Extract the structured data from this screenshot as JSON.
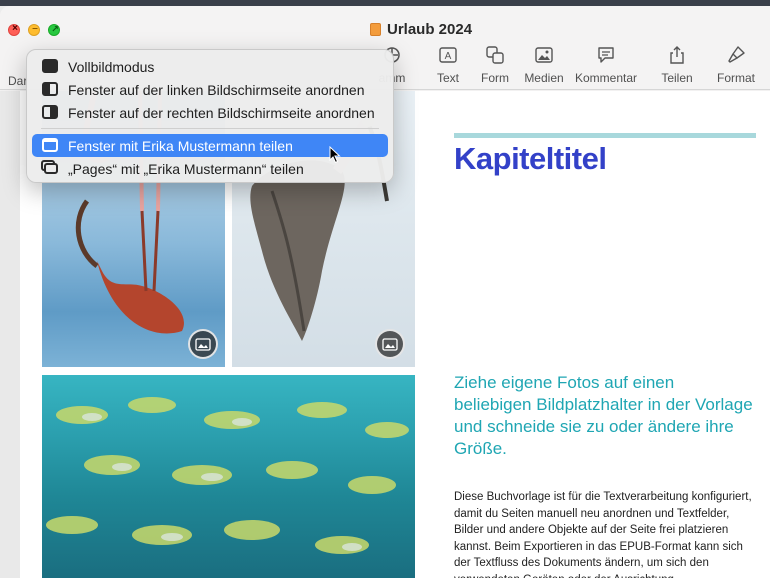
{
  "window": {
    "title": "Urlaub 2024"
  },
  "toolbar": {
    "left_partial_label": "Dar",
    "items": [
      {
        "label": "amm",
        "icon": "chart-icon"
      },
      {
        "label": "Text",
        "icon": "text-box-icon"
      },
      {
        "label": "Form",
        "icon": "shape-icon"
      },
      {
        "label": "Medien",
        "icon": "media-icon"
      },
      {
        "label": "Kommentar",
        "icon": "comment-icon"
      },
      {
        "label": "Teilen",
        "icon": "share-icon"
      },
      {
        "label": "Format",
        "icon": "format-brush-icon"
      }
    ]
  },
  "menu": {
    "items": [
      {
        "label": "Vollbildmodus",
        "icon": "fullscreen-icon"
      },
      {
        "label": "Fenster auf der linken Bildschirmseite anordnen",
        "icon": "tile-left-icon"
      },
      {
        "label": "Fenster auf der rechten Bildschirmseite anordnen",
        "icon": "tile-right-icon"
      },
      {
        "label": "Fenster mit Erika Mustermann teilen",
        "icon": "share-window-icon",
        "highlighted": true
      },
      {
        "label": "„Pages“ mit „Erika Mustermann“ teilen",
        "icon": "share-app-icon"
      }
    ]
  },
  "document": {
    "chapter_title": "Kapiteltitel",
    "lead": "Ziehe eigene Fotos auf einen beliebigen Bildplatzhalter in der Vorlage und schneide sie zu oder ändere ihre Größe.",
    "body": "Diese Buchvorlage ist für die Textverarbeitung konfiguriert, damit du Seiten manuell neu anordnen und Textfelder, Bilder und andere Objekte auf der Seite frei platzieren kannst. Beim Exportieren in das EPUB-Format kann sich der Textfluss des Dokuments ändern, um sich den verwendeten Geräten oder der Ausrichtung"
  },
  "colors": {
    "accent_title": "#3341c8",
    "lead_text": "#1fa6b3",
    "rule": "#a8d8dc",
    "menu_highlight": "#3f86f6"
  }
}
